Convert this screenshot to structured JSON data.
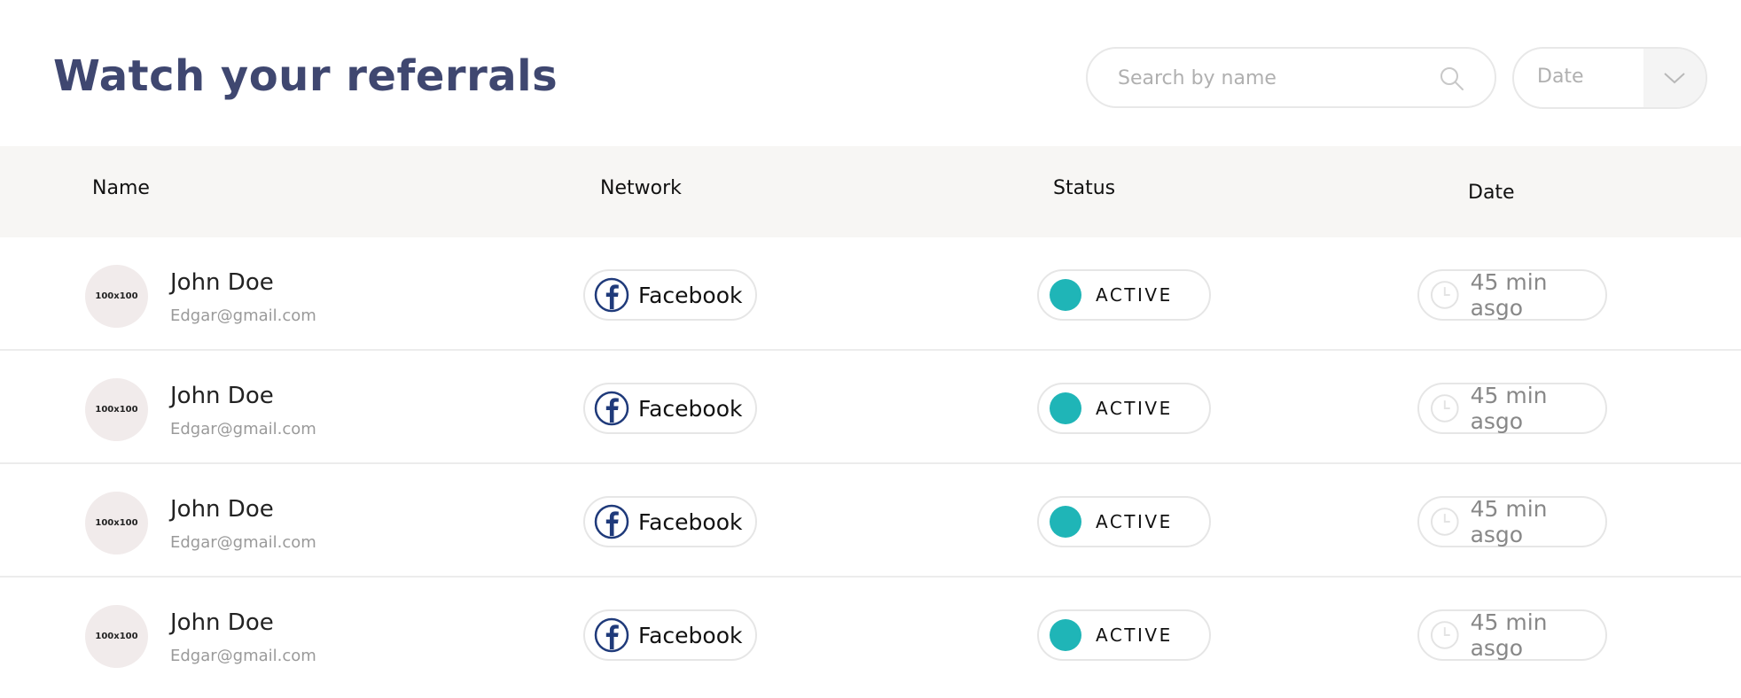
{
  "header": {
    "title": "Watch your referrals",
    "search_placeholder": "Search by name",
    "sort_select_value": "Date"
  },
  "table": {
    "columns": [
      "Name",
      "Network",
      "Status",
      "Date"
    ],
    "rows": [
      {
        "avatar_text": "100x100",
        "name": "John Doe",
        "email": "Edgar@gmail.com",
        "network": "Facebook",
        "status": "ACTIVE",
        "date": "45 min asgo"
      },
      {
        "avatar_text": "100x100",
        "name": "John Doe",
        "email": "Edgar@gmail.com",
        "network": "Facebook",
        "status": "ACTIVE",
        "date": "45 min asgo"
      },
      {
        "avatar_text": "100x100",
        "name": "John Doe",
        "email": "Edgar@gmail.com",
        "network": "Facebook",
        "status": "ACTIVE",
        "date": "45 min asgo"
      },
      {
        "avatar_text": "100x100",
        "name": "John Doe",
        "email": "Edgar@gmail.com",
        "network": "Facebook",
        "status": "ACTIVE",
        "date": "45 min asgo"
      }
    ]
  },
  "icons": {
    "search": "search-icon",
    "dropdown": "chevron-down-icon",
    "network": "facebook-icon",
    "date": "clock-icon"
  },
  "colors": {
    "title": "#3f4770",
    "status_active": "#1fb5b7",
    "facebook": "#1f3a7a",
    "header_bg": "#f7f6f4"
  }
}
